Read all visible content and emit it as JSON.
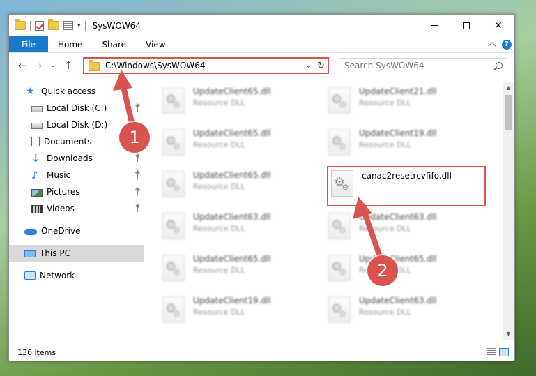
{
  "window": {
    "title": "SysWOW64",
    "controls": {
      "minimize": "—",
      "maximize": "☐",
      "close": "✕"
    }
  },
  "ribbon": {
    "tabs": [
      "File",
      "Home",
      "Share",
      "View"
    ],
    "help": "?"
  },
  "navigation": {
    "address": "C:\\Windows\\SysWOW64",
    "search_placeholder": "Search SysWOW64"
  },
  "sidebar": {
    "items": [
      {
        "label": "Quick access",
        "icon": "star-icon"
      },
      {
        "label": "Local Disk (C:)",
        "icon": "disk-icon",
        "pinned": true
      },
      {
        "label": "Local Disk (D:)",
        "icon": "disk-icon",
        "pinned": false
      },
      {
        "label": "Documents",
        "icon": "documents-icon",
        "pinned": true
      },
      {
        "label": "Downloads",
        "icon": "downloads-icon",
        "pinned": true
      },
      {
        "label": "Music",
        "icon": "music-icon",
        "pinned": true
      },
      {
        "label": "Pictures",
        "icon": "pictures-icon",
        "pinned": true
      },
      {
        "label": "Videos",
        "icon": "videos-icon",
        "pinned": true
      },
      {
        "label": "OneDrive",
        "icon": "onedrive-icon"
      },
      {
        "label": "This PC",
        "icon": "pc-icon",
        "selected": true
      },
      {
        "label": "Network",
        "icon": "network-icon"
      }
    ]
  },
  "files": {
    "left_column": [
      {
        "name": "UpdateClient65.dll",
        "type": "Resource DLL"
      },
      {
        "name": "UpdateClient65.dll",
        "type": "Resource DLL"
      },
      {
        "name": "UpdateClient65.dll",
        "type": "Resource DLL"
      },
      {
        "name": "UpdateClient63.dll",
        "type": "Resource DLL"
      },
      {
        "name": "UpdateClient65.dll",
        "type": "Resource DLL"
      },
      {
        "name": "UpdateClient19.dll",
        "type": "Resource DLL"
      }
    ],
    "right_column": [
      {
        "name": "UpdateClient21.dll",
        "type": "Resource DLL"
      },
      {
        "name": "UpdateClient19.dll",
        "type": "Resource DLL"
      },
      {
        "name": "canac2resetrcvfifo.dll",
        "type": "",
        "highlighted": true
      },
      {
        "name": "UpdateClient63.dll",
        "type": "Resource DLL"
      },
      {
        "name": "UpdateClient65.dll",
        "type": "Resource DLL"
      },
      {
        "name": "UpdateClient63.dll",
        "type": "Resource DLL"
      }
    ]
  },
  "status": {
    "item_count": "136 items"
  },
  "annotations": {
    "step1": "1",
    "step2": "2",
    "color": "#d9534f"
  }
}
